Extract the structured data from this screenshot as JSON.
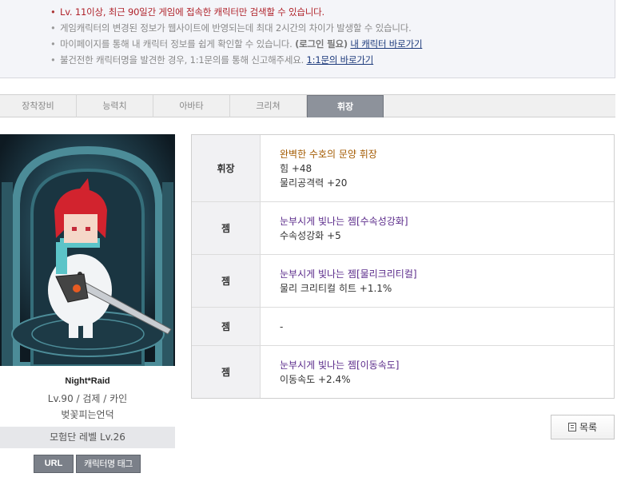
{
  "notice": {
    "lines": [
      "Lv. 11이상, 최근 90일간 게임에 접속한 캐릭터만 검색할 수 있습니다.",
      "게임캐릭터의 변경된 정보가 웹사이트에 반영되는데 최대 2시간의 차이가 발생할 수 있습니다.",
      "마이페이지를 통해 내 캐릭터 정보를 쉽게 확인할 수 있습니다.",
      "불건전한 캐릭터명을 발견한 경우, 1:1문의를 통해 신고해주세요."
    ],
    "login_required": "(로그인 필요)",
    "my_char_link": "내 캐릭터 바로가기",
    "inquiry_link": "1:1문의 바로가기"
  },
  "tabs": [
    "장착장비",
    "능력치",
    "아바타",
    "크리쳐",
    "휘장"
  ],
  "active_tab": 4,
  "character": {
    "name": "Night*Raid",
    "info": "Lv.90 / 검제 / 카인",
    "server": "벚꽃피는언덕",
    "adventure_level": "모험단 레벨 Lv.26",
    "url_button": "URL",
    "tag_button": "캐릭터명 태그"
  },
  "items": [
    {
      "slot": "휘장",
      "name": "완벽한 수호의 문양 휘장",
      "name_color": "orange",
      "stats": [
        "힘 +48",
        "물리공격력 +20"
      ]
    },
    {
      "slot": "젬",
      "name": "눈부시게 빛나는 젬[수속성강화]",
      "name_color": "purple",
      "stats": [
        "수속성강화 +5"
      ]
    },
    {
      "slot": "젬",
      "name": "눈부시게 빛나는 젬[물리크리티컬]",
      "name_color": "purple",
      "stats": [
        "물리 크리티컬 히트 +1.1%"
      ]
    },
    {
      "slot": "젬",
      "name": "",
      "name_color": "",
      "stats": [
        "-"
      ]
    },
    {
      "slot": "젬",
      "name": "눈부시게 빛나는 젬[이동속도]",
      "name_color": "purple",
      "stats": [
        "이동속도 +2.4%"
      ]
    }
  ],
  "list_button": "목록",
  "icons": [
    "list-icon"
  ]
}
